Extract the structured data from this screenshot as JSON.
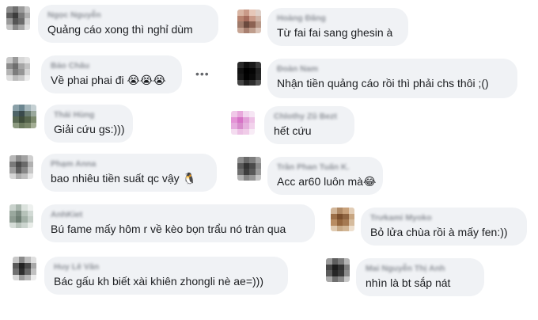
{
  "comments": [
    {
      "name": "Ngọc Nguyễn",
      "text": "Quảng cáo xong thì nghỉ dùm"
    },
    {
      "name": "Hoàng Đăng",
      "text": "Từ fai fai sang ghesin à"
    },
    {
      "name": "Bảo Châu",
      "text": "Về phai phai đi 😭😭😭"
    },
    {
      "name": "Đoàn Nam",
      "text": "Nhận tiền quảng cáo rồi thì phải chs thôi ;()"
    },
    {
      "name": "Thái Hùng",
      "text": "Giải cứu gs:)))"
    },
    {
      "name": "Chlothy Zũ Bezt",
      "text": "hết cứu"
    },
    {
      "name": "Phạm Anna",
      "text": "bao nhiêu tiền suất qc vậy 🐧"
    },
    {
      "name": "Trần Phan Tuấn K.",
      "text": "Acc ar60 luôn mà😂"
    },
    {
      "name": "AnhKiet",
      "text": "Bú fame mấy hôm r về kèo bọn trẩu nó tràn qua"
    },
    {
      "name": "Trưkami Myoko",
      "text": "Bỏ lửa chùa rồi à mấy fen:))"
    },
    {
      "name": "Huy Lê Văn",
      "text": "Bác gấu kh biết xài khiên zhongli nè ae=)))"
    },
    {
      "name": "Mai Nguyễn Thị Anh",
      "text": "nhìn là bt sắp nát"
    }
  ],
  "more_label": "•••"
}
